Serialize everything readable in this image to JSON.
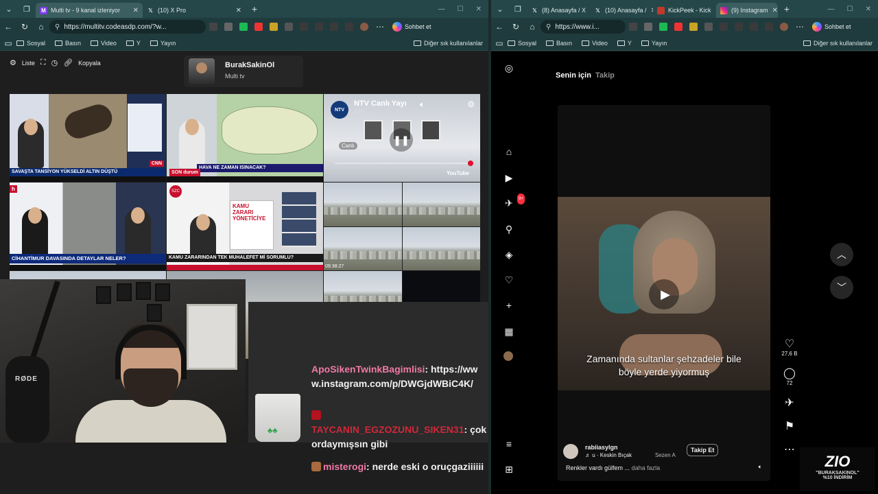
{
  "left": {
    "tabs": [
      {
        "title": "Multi tv - 9 kanal izleniyor",
        "active": true
      },
      {
        "title": "(10) X Pro",
        "active": false
      }
    ],
    "url": "https://multitv.codeasdp.com/?w...",
    "copilot": "Sohbet et",
    "bookmarks": [
      "Sosyal",
      "Basın",
      "Video",
      "Y",
      "Yayın"
    ],
    "other_bookmarks": "Diğer sık kullanılanlar",
    "toolbar": {
      "list": "Liste",
      "copy": "Kopyala"
    },
    "channel": {
      "name": "BurakSakinOl",
      "subtitle": "Multi tv"
    },
    "tiles": {
      "t1_headline": "SAVAŞTA TANSİYON YÜKSELDİ ALTIN DÜŞTÜ",
      "t1_logo": "CNN",
      "t2_headline": "HAVA NE ZAMAN ISINACAK?",
      "t2_logo": "SON durum",
      "t3_title": "NTV Canlı Yayı",
      "t3_sub": "NTV",
      "t3_live": "Canlı",
      "t3_brand": "YouTube",
      "t4_headline": "CİHANTİMUR DAVASINDA DETAYLAR NELER?",
      "t5_headline": "KAMU ZARARINDAN TEK MUHALEFET Mİ SORUMLU?",
      "t5_board": "KAMU ZARARI YÖNETİCİYE",
      "t6_time": "09:38:27"
    },
    "chat": [
      {
        "user": "ApoSikenTwinkBagimlisi",
        "text": "https://www.instagram.com/p/DWGjdWBiC4K/"
      },
      {
        "user": "TAYCANIN_EGZOZUNU_SIKEN31",
        "text": "çok ordaymışsın gibi"
      },
      {
        "user": "misterogi",
        "text": "nerde eski o oruçgaziiiiii"
      }
    ],
    "mic_brand": "RØDE"
  },
  "right": {
    "tabs": [
      {
        "title": "(8) Anasayfa / X",
        "active": false
      },
      {
        "title": "(10) Anasayfa /",
        "active": false
      },
      {
        "title": "KickPeek - Kick",
        "active": false
      },
      {
        "title": "(9) Instagram",
        "active": true
      }
    ],
    "url": "https://www.i...",
    "copilot": "Sohbet et",
    "bookmarks": [
      "Sosyal",
      "Basın",
      "Video",
      "Y",
      "Yayın"
    ],
    "other_bookmarks": "Diğer sık kullanılanlar",
    "ig": {
      "tab_for_you": "Senin için",
      "tab_follow": "Takip",
      "notif_count": "9+",
      "caption_line1": "Zamanında sultanlar şehzadeler bile",
      "caption_line2": "böyle yerde yiyormuş",
      "username": "rabiiasylgn",
      "song": "♬ u · Keskin Bıçak",
      "song2": "Sezen A",
      "follow": "Takip Et",
      "description": "Renkler vardı gülfem ...",
      "more": "daha fazla",
      "likes": "27,6 B",
      "comments": "72"
    },
    "promo": {
      "brand": "ZIO",
      "code": "\"BURAKSAKINOL\"",
      "discount": "%10 İNDİRİM"
    }
  },
  "colors": {
    "frame": "#25474a",
    "accent_pink": "#f07aa5",
    "live_red": "#e0102e"
  }
}
